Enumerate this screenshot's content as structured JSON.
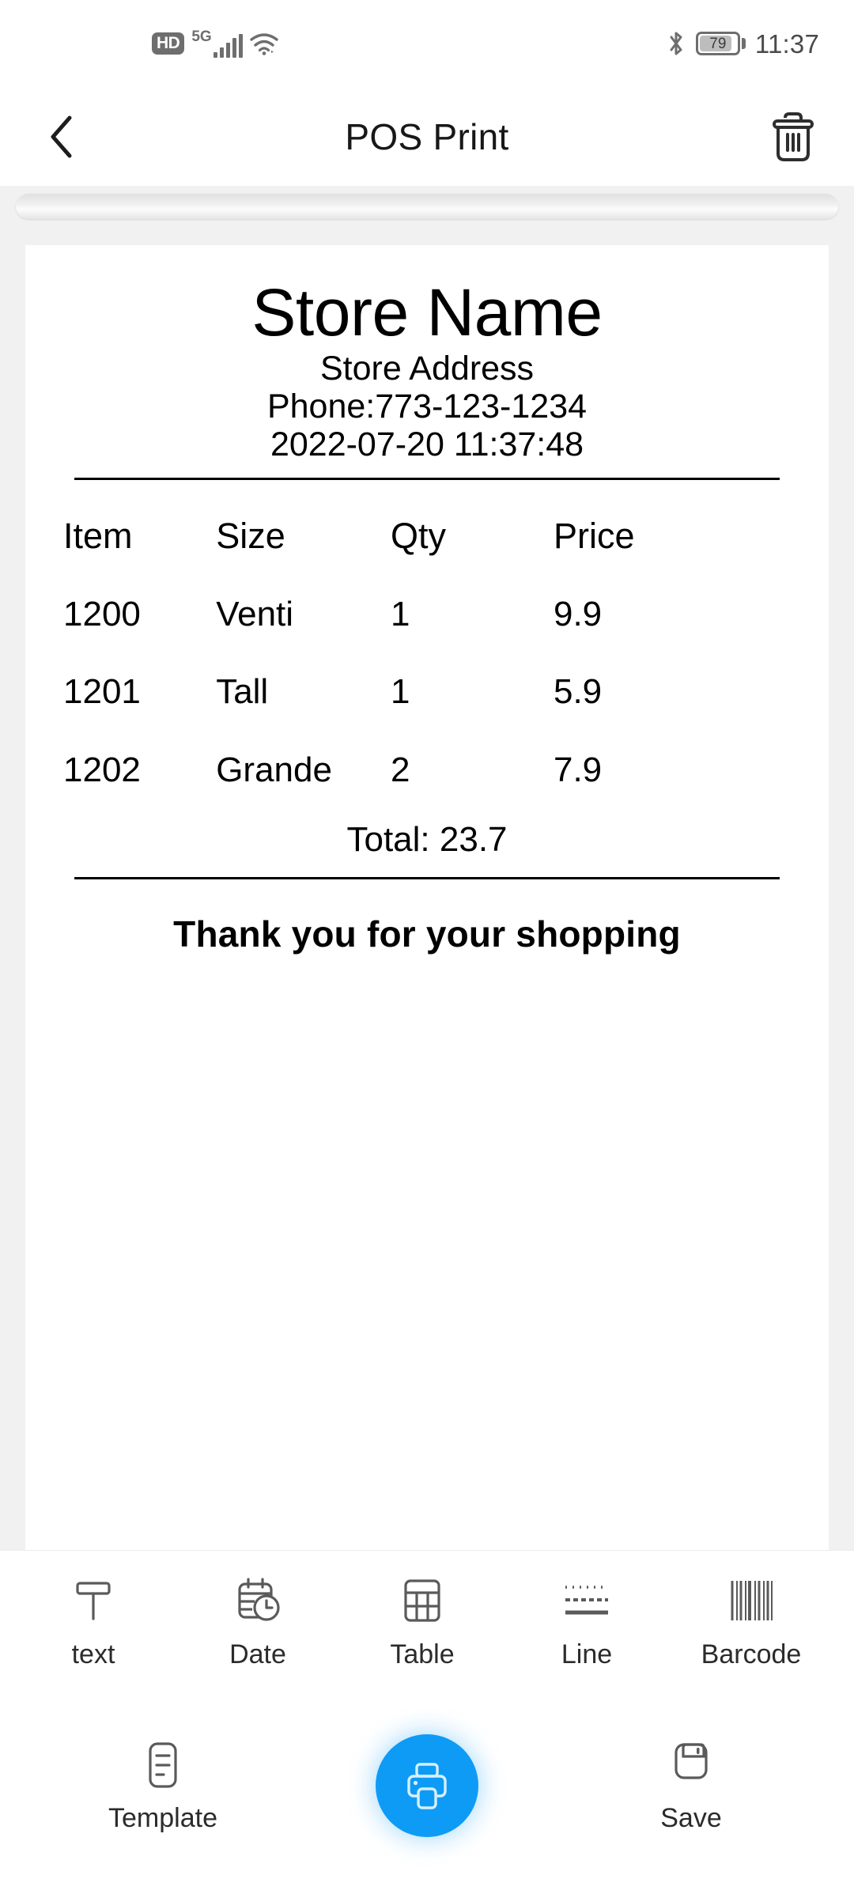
{
  "statusbar": {
    "hd_label": "HD",
    "network_label": "5G",
    "battery_percent": "79",
    "time": "11:37",
    "icons": [
      "hd-badge-icon",
      "signal-bars-icon",
      "wifi-icon",
      "bluetooth-icon",
      "battery-icon"
    ]
  },
  "appbar": {
    "back_icon": "back-chevron-icon",
    "title": "POS Print",
    "delete_icon": "trash-icon"
  },
  "receipt": {
    "store_name": "Store Name",
    "store_address": "Store Address",
    "phone": "Phone:773-123-1234",
    "datetime": "2022-07-20 11:37:48",
    "columns": [
      "Item",
      "Size",
      "Qty",
      "Price"
    ],
    "rows": [
      [
        "1200",
        "Venti",
        "1",
        "9.9"
      ],
      [
        "1201",
        "Tall",
        "1",
        "5.9"
      ],
      [
        "1202",
        "Grande",
        "2",
        "7.9"
      ]
    ],
    "total": "Total: 23.7",
    "footer": "Thank you for your shopping"
  },
  "toolbar": {
    "items": [
      {
        "label": "text",
        "icon": "text-t-icon"
      },
      {
        "label": "Date",
        "icon": "calendar-clock-icon"
      },
      {
        "label": "Table",
        "icon": "table-grid-icon"
      },
      {
        "label": "Line",
        "icon": "line-styles-icon"
      },
      {
        "label": "Barcode",
        "icon": "barcode-icon"
      }
    ]
  },
  "actionbar": {
    "template_label": "Template",
    "template_icon": "document-lines-icon",
    "print_icon": "printer-icon",
    "save_label": "Save",
    "save_icon": "floppy-disk-icon"
  },
  "colors": {
    "accent": "#0e9bf5",
    "canvas_bg": "#f1f1f1",
    "icon_gray": "#5a5a5a",
    "status_gray": "#6e6e6e"
  }
}
